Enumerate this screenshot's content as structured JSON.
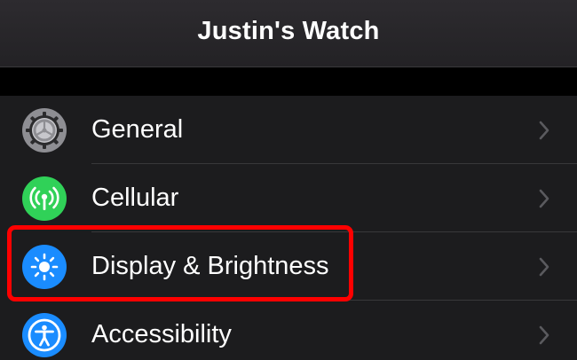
{
  "header": {
    "title": "Justin's Watch"
  },
  "settings": {
    "items": [
      {
        "label": "General",
        "icon": "gear-icon",
        "icon_color": "#8e8e93"
      },
      {
        "label": "Cellular",
        "icon": "antenna-icon",
        "icon_color": "#30d158"
      },
      {
        "label": "Display & Brightness",
        "icon": "sun-icon",
        "icon_color": "#1a8cff"
      },
      {
        "label": "Accessibility",
        "icon": "accessibility-icon",
        "icon_color": "#1a8cff"
      }
    ]
  },
  "annotation": {
    "highlight_color": "#ff0000",
    "highlighted_item": "Display & Brightness"
  }
}
